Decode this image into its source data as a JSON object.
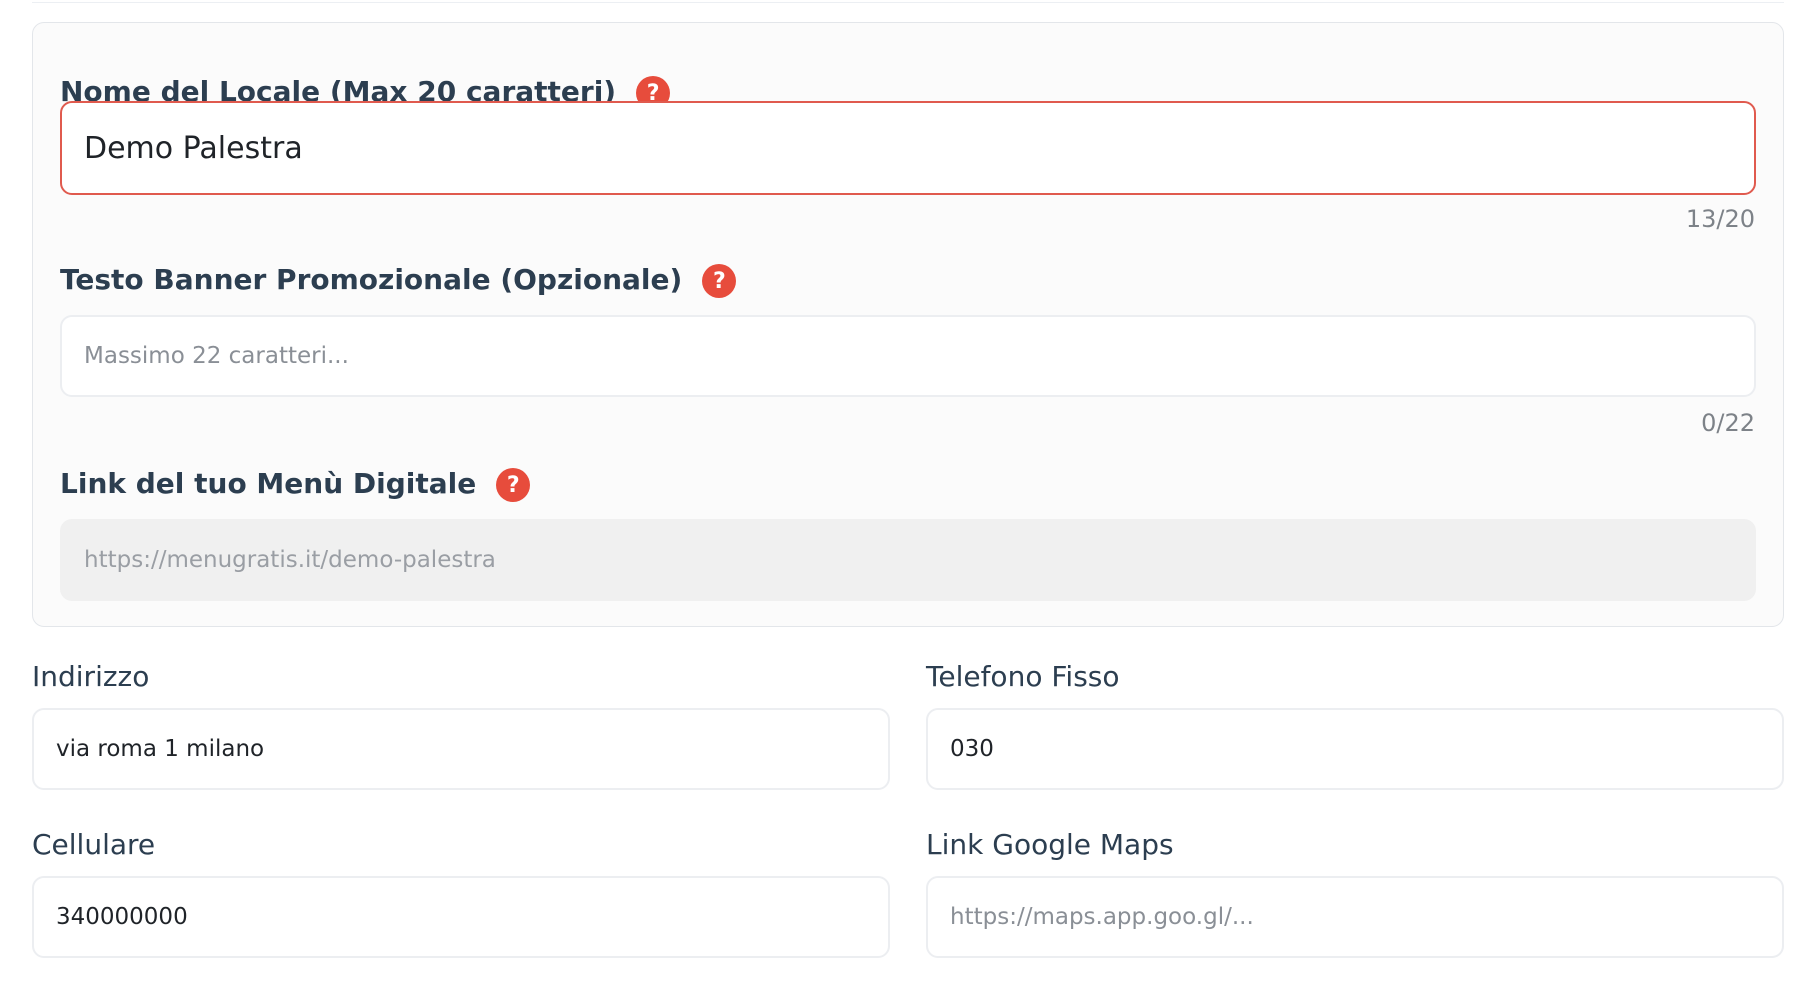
{
  "locale_card": {
    "name": {
      "label": "Nome del Locale (Max 20 caratteri)",
      "value": "Demo Palestra",
      "counter": "13/20"
    },
    "banner": {
      "label": "Testo Banner Promozionale (Opzionale)",
      "value": "",
      "placeholder": "Massimo 22 caratteri...",
      "counter": "0/22"
    },
    "menu_link": {
      "label": "Link del tuo Menù Digitale",
      "value": "https://menugratis.it/demo-palestra"
    },
    "help_glyph": "?"
  },
  "contact": {
    "address": {
      "label": "Indirizzo",
      "value": "via roma 1 milano"
    },
    "landline": {
      "label": "Telefono Fisso",
      "value": "030"
    },
    "mobile": {
      "label": "Cellulare",
      "value": "340000000"
    },
    "maps": {
      "label": "Link Google Maps",
      "value": "",
      "placeholder": "https://maps.app.goo.gl/..."
    }
  },
  "colors": {
    "accent_red": "#e74c3c",
    "label_text": "#2c3e50",
    "readonly_bg": "#f0f0f0"
  }
}
